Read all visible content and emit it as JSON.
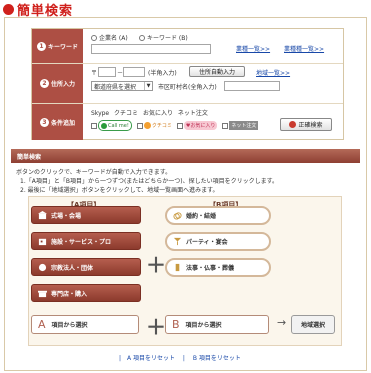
{
  "header": {
    "title": "簡単検索"
  },
  "form": {
    "keyword": {
      "num": "1",
      "label": "キーワード",
      "radio_a": "企業名 (A)",
      "radio_b": "キーワード (B)",
      "link1": "業種一覧>>",
      "link2": "業種種一覧>>"
    },
    "address": {
      "num": "2",
      "label": "住所入力",
      "zip_prefix": "〒",
      "zip_sep": "－",
      "zip_note": "(半角入力)",
      "auto_btn": "住所自動入力",
      "pref_select": "都道府県を選択",
      "city_label": "市区町村名(全角入力)",
      "area_link": "地域一覧>>"
    },
    "conditions": {
      "num": "3",
      "label": "条件追加",
      "items": [
        "Skype",
        "クチコミ",
        "お気に入り",
        "ネット注文"
      ],
      "icon_texts": [
        "Call me!",
        "クチコミ",
        "お気に入り",
        "ネット注文"
      ],
      "search_btn": "正確検索"
    }
  },
  "banner": {
    "title": "簡単検索"
  },
  "description": {
    "line1": "ボタンのクリックで、キーワードが自動で入力できます。",
    "step1": "1.「A項目」と「B項目」から一つずつ(またはどちらか一つ)、探したい項目をクリックします。",
    "step2": "2. 最後に「地域選択」ボタンをクリックして、地域一覧画面へ進みます。"
  },
  "categories": {
    "a_header": "【A項目】",
    "b_header": "【B項目】",
    "a_items": [
      "式場・会場",
      "施設・サービス・プロ",
      "宗教法人・団体",
      "専門店・購入"
    ],
    "b_items": [
      "婚約・結婚",
      "パーティ・宴会",
      "法事・仏事・葬儀"
    ],
    "plus": "＋"
  },
  "selection": {
    "a_letter": "A",
    "a_label": "項目から選択",
    "b_letter": "B",
    "b_label": "項目から選択",
    "area_btn": "地域選択",
    "arrow": "→"
  },
  "reset": {
    "a": "A 項目をリセット",
    "sep": "|",
    "b": "B 項目をリセット"
  },
  "colors": {
    "accent_red": "#d0211c",
    "brown": "#ad4f44"
  }
}
